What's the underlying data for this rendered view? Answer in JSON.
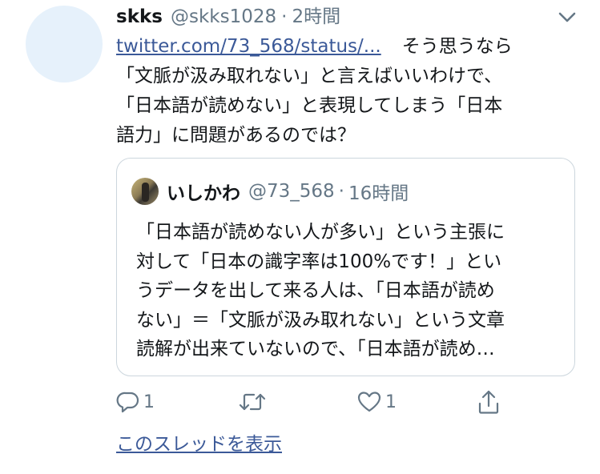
{
  "tweet": {
    "author_name": "skks",
    "author_handle": "@skks1028",
    "separator": "·",
    "time": "2時間",
    "link_text": "twitter.com/73_568/status/...",
    "text_line1_after_link": "そう思うなら",
    "text_lines": [
      "「文脈が汲み取れない」と言えばいいわけで、",
      "「日本語が読めない」と表現してしまう「日本",
      "語力」に問題があるのでは？"
    ]
  },
  "quote": {
    "author_name": "いしかわ",
    "author_handle": "@73_568",
    "separator": "·",
    "time": "16時間",
    "text_lines": [
      "「日本語が読めない人が多い」という主張に",
      "対して「日本の識字率は100%です！」とい",
      "うデータを出して来る人は、「日本語が読め",
      "ない」＝「文脈が汲み取れない」という文章",
      "読解が出来ていないので、「日本語が読め…"
    ]
  },
  "actions": {
    "reply_count": "1",
    "like_count": "1",
    "icons": [
      "reply-icon",
      "retweet-icon",
      "like-icon",
      "share-icon"
    ]
  },
  "show_thread": "このスレッドを表示",
  "colors": {
    "link": "#3b5998",
    "secondary": "#657786",
    "primary_text": "#14171a",
    "border": "#ccd6dd",
    "avatar_placeholder": "#e6f1fb"
  }
}
